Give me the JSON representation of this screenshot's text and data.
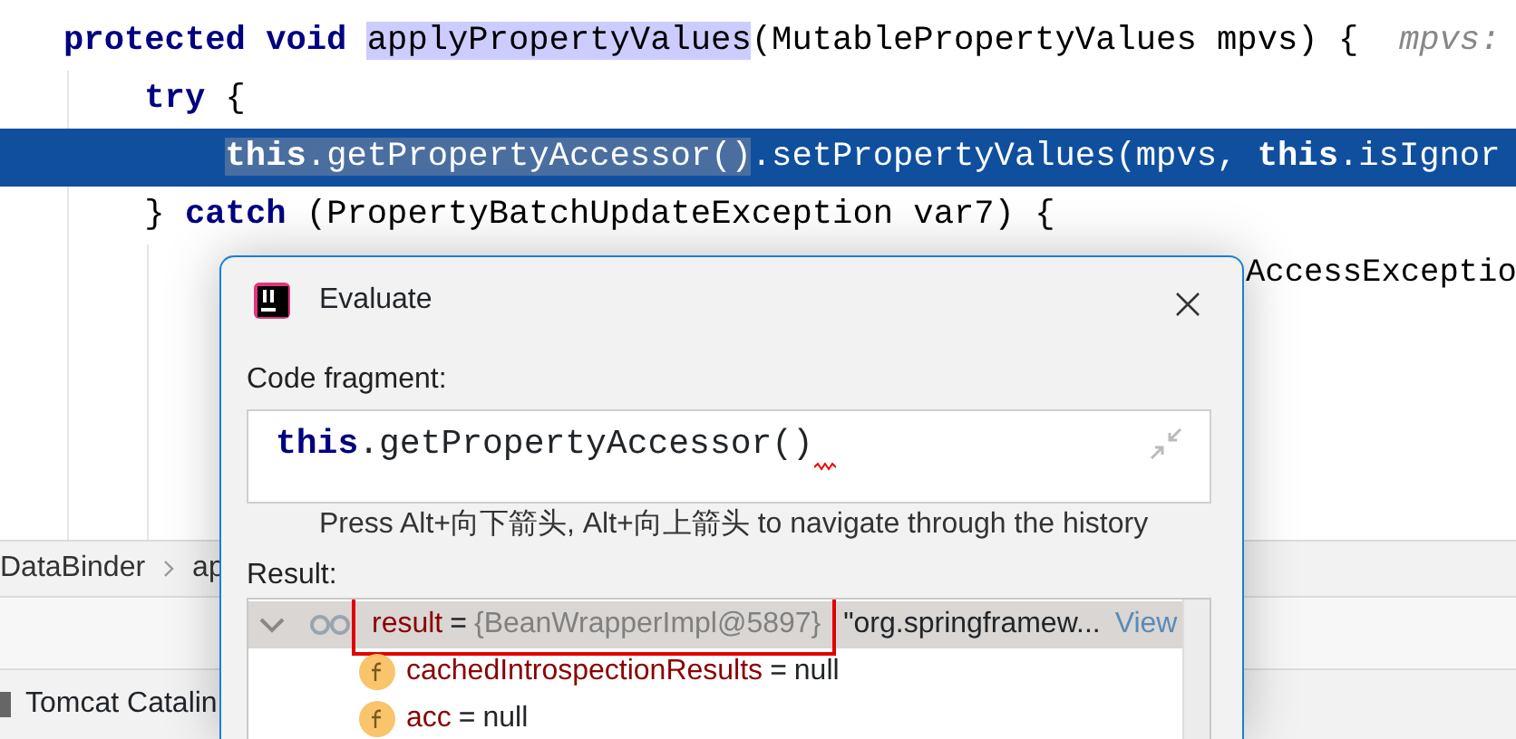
{
  "editor": {
    "lines": [
      {
        "current": false,
        "tokens": [
          {
            "text": "protected void ",
            "kind": "keyword"
          },
          {
            "text": "applyPropertyValues",
            "kind": "usage"
          },
          {
            "text": "(MutablePropertyValues mpvs) {",
            "kind": "plain"
          },
          {
            "text": "  mpvs:",
            "kind": "hint"
          }
        ]
      },
      {
        "current": false,
        "tokens": [
          {
            "text": "    try",
            "kind": "keyword"
          },
          {
            "text": " {",
            "kind": "plain"
          }
        ]
      },
      {
        "current": true,
        "selection": [
          {
            "text": "        this",
            "kind": "keyword"
          },
          {
            "text": ".getPropertyAccessor()",
            "kind": "plain"
          }
        ],
        "tokens": [
          {
            "text": ".setPropertyValues(mpvs, ",
            "kind": "plain"
          },
          {
            "text": "this",
            "kind": "keyword"
          },
          {
            "text": ".isIgnor",
            "kind": "plain"
          }
        ]
      },
      {
        "current": false,
        "tokens": [
          {
            "text": "    } ",
            "kind": "plain"
          },
          {
            "text": "catch",
            "kind": "keyword"
          },
          {
            "text": " (PropertyBatchUpdateException var7) {",
            "kind": "plain"
          }
        ]
      },
      {
        "current": false,
        "obscured": true,
        "tokens": [
          {
            "text": "AccessExceptio",
            "kind": "plain"
          }
        ]
      }
    ]
  },
  "breadcrumbs": [
    "DataBinder",
    "ap"
  ],
  "tool_windows": [
    {
      "label": "Tomcat Catalin"
    }
  ],
  "dialog": {
    "title": "Evaluate",
    "code_label": "Code fragment:",
    "code": [
      {
        "text": "this",
        "kind": "keyword"
      },
      {
        "text": ".getPropertyAccessor()",
        "kind": "plain"
      }
    ],
    "code_error": true,
    "hint": "Press Alt+向下箭头, Alt+向上箭头 to navigate through the history",
    "result_label": "Result:",
    "result": [
      {
        "kind": "watch",
        "name": "result",
        "operator": "=",
        "value": "{BeanWrapperImpl@5897}",
        "extra": " \"org.springframew...",
        "link": "View",
        "expanded": true,
        "selected": true,
        "highlighted": true,
        "children": [
          {
            "kind": "field",
            "name": "cachedIntrospectionResults",
            "operator": "=",
            "value": "null",
            "selected": false,
            "highlighted": false
          },
          {
            "kind": "field",
            "name": "acc",
            "operator": "=",
            "value": "null",
            "selected": false,
            "highlighted": false
          }
        ]
      }
    ]
  }
}
